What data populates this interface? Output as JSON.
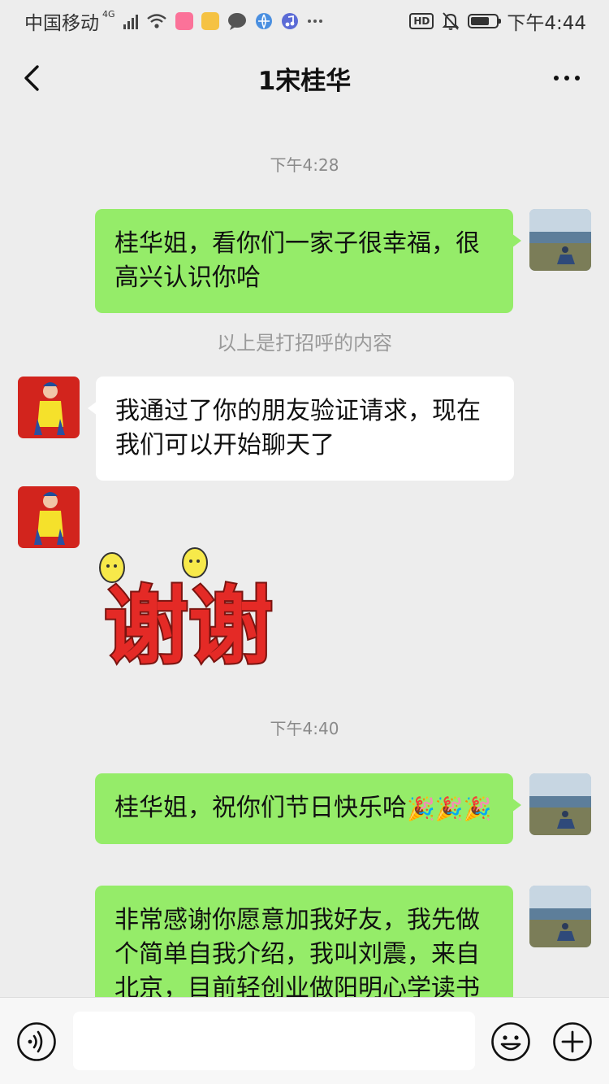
{
  "status_bar": {
    "carrier": "中国移动",
    "network": "4G",
    "time": "下午4:44",
    "hd_label": "HD",
    "icons": [
      "signal-icon",
      "wifi-icon",
      "bilibili-app-icon",
      "notes-app-icon",
      "chat-app-icon",
      "browser-app-icon",
      "music-app-icon",
      "more-dots-icon",
      "mute-bell-icon",
      "battery-icon"
    ]
  },
  "header": {
    "title": "1宋桂华",
    "back_icon": "chevron-left-icon",
    "more_icon": "more-dots-icon"
  },
  "messages": {
    "time_1": "下午4:28",
    "msg_1": "桂华姐，看你们一家子很幸福，很高兴认识你哈",
    "system_note": "以上是打招呼的内容",
    "msg_2": "我通过了你的朋友验证请求，现在我们可以开始聊天了",
    "sticker_text": "谢谢",
    "time_2": "下午4:40",
    "msg_3_text": "桂华姐，祝你们节日快乐哈",
    "msg_3_emojis": [
      "🎉",
      "🎉",
      "🎉"
    ],
    "msg_4": "非常感谢你愿意加我好友，我先做个简单自我介绍，我叫刘震，来自北京，目前轻创业做阳明心学读书"
  },
  "input_bar": {
    "value": "",
    "voice_icon": "voice-icon",
    "emoji_icon": "emoji-face-icon",
    "plus_icon": "plus-circle-icon"
  },
  "colors": {
    "background": "#ededed",
    "my_bubble": "#95ec69",
    "their_bubble": "#ffffff",
    "timestamp_text": "#8a8a8a"
  }
}
